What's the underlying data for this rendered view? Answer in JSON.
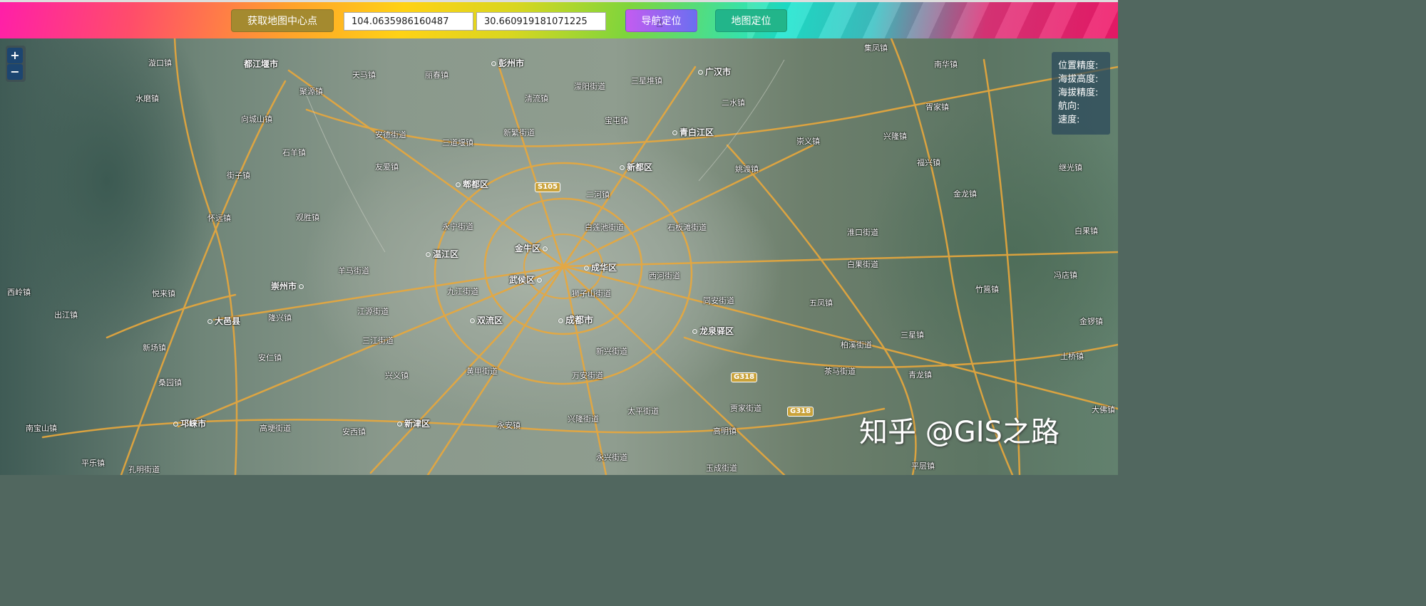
{
  "toolbar": {
    "get_center_label": "获取地图中心点",
    "longitude_value": "104.0635986160487",
    "latitude_value": "30.660919181071225",
    "navigate_label": "导航定位",
    "map_locate_label": "地图定位"
  },
  "zoom": {
    "in": "+",
    "out": "−"
  },
  "info_panel": {
    "position_accuracy": "位置精度:",
    "altitude": "海拔高度:",
    "altitude_accuracy": "海拔精度:",
    "heading": "航向:",
    "speed": "速度:"
  },
  "road_shields": [
    "S105",
    "G318",
    "G318"
  ],
  "place_labels": [
    "漩口镇",
    "都江堰市",
    "天马镇",
    "丽春镇",
    "彭州市",
    "广汉市",
    "集凤镇",
    "南华镇",
    "聚源镇",
    "濛阳街道",
    "三星堆镇",
    "水磨镇",
    "清流镇",
    "胥家镇",
    "二水镇",
    "新繁街道",
    "宝屯镇",
    "向城山镇",
    "安德街道",
    "青白江区",
    "崇义镇",
    "兴隆镇",
    "三道堰镇",
    "石羊镇",
    "街子镇",
    "友爱镇",
    "郫都区",
    "新都区",
    "姚渡镇",
    "福兴镇",
    "继光镇",
    "怀远镇",
    "观胜镇",
    "二河镇",
    "金龙镇",
    "永宁街道",
    "白莲池街道",
    "石板滩街道",
    "淮口街道",
    "白果镇",
    "温江区",
    "金牛区",
    "成华区",
    "西河街道",
    "白果街道",
    "羊马街道",
    "崇州市",
    "武侯区",
    "九江街道",
    "狮子山街道",
    "西岭镇",
    "悦来镇",
    "五凤镇",
    "竹篙镇",
    "冯店镇",
    "出江镇",
    "大邑县",
    "隆兴镇",
    "江源街道",
    "双流区",
    "成都市",
    "同安街道",
    "龙泉驿区",
    "金锣镇",
    "三江街道",
    "三星镇",
    "新场镇",
    "安仁镇",
    "新兴街道",
    "柏溪街道",
    "土桥镇",
    "兴义镇",
    "黄甲街道",
    "万安街道",
    "茶马街道",
    "青龙镇",
    "桑园镇",
    "太平街道",
    "贾家街道",
    "南宝山镇",
    "邛崃市",
    "高埂街道",
    "安西镇",
    "新津区",
    "永安镇",
    "兴隆街道",
    "高明镇",
    "大佛镇",
    "平乐镇",
    "孔明街道",
    "永兴街道",
    "玉成街道",
    "平层镇"
  ],
  "watermark": "知乎 @GIS之路",
  "colors": {
    "road": "#e9a83c",
    "button_center": "#a48a2f",
    "button_locate": "#22b58a",
    "info_panel": "#28465a"
  }
}
